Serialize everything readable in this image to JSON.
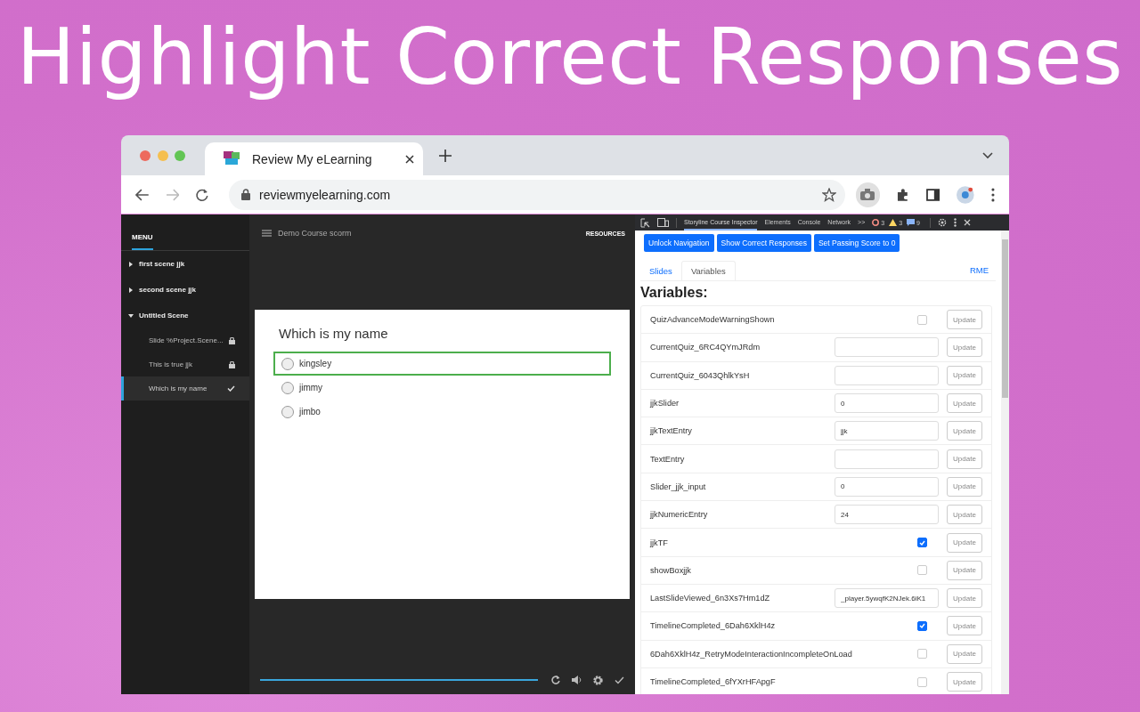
{
  "headline": "Highlight Correct Responses",
  "browser": {
    "tab_title": "Review My eLearning",
    "url": "reviewmyelearning.com"
  },
  "course": {
    "menu_label": "MENU",
    "title": "Demo Course scorm",
    "resources_label": "RESOURCES",
    "menu": [
      {
        "label": "first scene jjk",
        "expanded": false
      },
      {
        "label": "second scene jjk",
        "expanded": false
      },
      {
        "label": "Untitled Scene",
        "expanded": true,
        "children": [
          {
            "label": "Slide %Project.Scene...",
            "kind": "locked",
            "selected": false
          },
          {
            "label": "This is true jjk",
            "kind": "locked",
            "selected": false
          },
          {
            "label": "Which is my name",
            "kind": "complete",
            "selected": true
          }
        ]
      }
    ],
    "question": "Which is my name",
    "options": [
      {
        "label": "kingsley",
        "highlighted": true,
        "selected": false
      },
      {
        "label": "jimmy",
        "highlighted": false,
        "selected": false
      },
      {
        "label": "jimbo",
        "highlighted": false,
        "selected": false
      }
    ],
    "progress": {
      "level": 1
    }
  },
  "devtools": {
    "tabs": [
      {
        "label": "Storyline Course Inspector",
        "selected": true
      },
      {
        "label": "Elements",
        "selected": false
      },
      {
        "label": "Console",
        "selected": false
      },
      {
        "label": "Network",
        "selected": false
      }
    ],
    "overflow": ">>",
    "errors": "3",
    "warnings": "3",
    "messages": "9"
  },
  "inspector": {
    "actions": [
      "Unlock Navigation",
      "Show Correct Responses",
      "Set Passing Score to 0"
    ],
    "tabs": [
      {
        "label": "Slides",
        "selected": false
      },
      {
        "label": "Variables",
        "selected": true
      }
    ],
    "link": "RME",
    "heading": "Variables:",
    "variables": [
      {
        "name": "QuizAdvanceModeWarningShown",
        "kind": "checkbox",
        "checked": false,
        "update": "Update"
      },
      {
        "name": "CurrentQuiz_6RC4QYmJRdm",
        "kind": "text",
        "update": "Update"
      },
      {
        "name": "CurrentQuiz_6043QhlkYsH",
        "kind": "text",
        "update": "Update"
      },
      {
        "name": "jjkSlider",
        "kind": "text",
        "value": "0",
        "update": "Update"
      },
      {
        "name": "jjkTextEntry",
        "kind": "text",
        "value": "jjk",
        "update": "Update"
      },
      {
        "name": "TextEntry",
        "kind": "text",
        "update": "Update"
      },
      {
        "name": "Slider_jjk_input",
        "kind": "text",
        "value": "0",
        "update": "Update"
      },
      {
        "name": "jjkNumericEntry",
        "kind": "text",
        "value": "24",
        "update": "Update"
      },
      {
        "name": "jjkTF",
        "kind": "checkbox",
        "checked": true,
        "update": "Update"
      },
      {
        "name": "showBoxjjk",
        "kind": "checkbox",
        "checked": false,
        "update": "Update"
      },
      {
        "name": "LastSlideViewed_6n3Xs7Hm1dZ",
        "kind": "text",
        "value": "_player.5ywqfK2NJek.6iK1",
        "update": "Update"
      },
      {
        "name": "TimelineCompleted_6Dah6XklH4z",
        "kind": "checkbox",
        "checked": true,
        "update": "Update"
      },
      {
        "name": "6Dah6XklH4z_RetryModeInteractionIncompleteOnLoad",
        "kind": "checkbox",
        "checked": false,
        "update": "Update"
      },
      {
        "name": "TimelineCompleted_6fYXrHFApgF",
        "kind": "checkbox",
        "checked": false,
        "update": "Update"
      }
    ]
  }
}
